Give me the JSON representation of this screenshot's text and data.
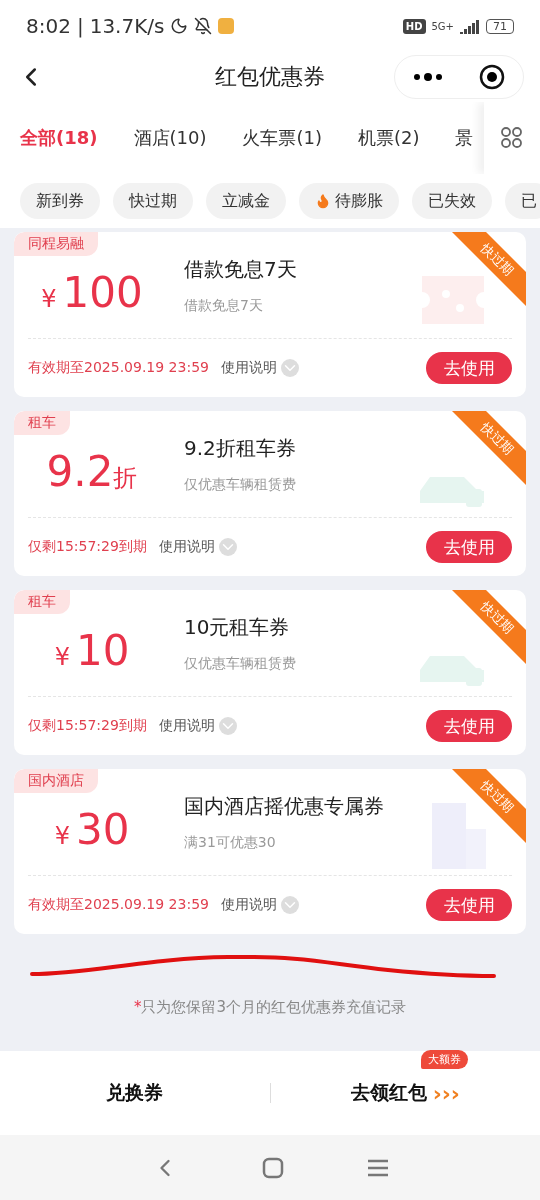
{
  "status_bar": {
    "time": "8:02",
    "separator": "|",
    "speed": "13.7K/s",
    "hd": "HD",
    "network": "5G+",
    "battery": "71"
  },
  "nav": {
    "title": "红包优惠券"
  },
  "tabs": [
    {
      "label": "全部(18)",
      "selected": true
    },
    {
      "label": "酒店(10)",
      "selected": false
    },
    {
      "label": "火车票(1)",
      "selected": false
    },
    {
      "label": "机票(2)",
      "selected": false
    },
    {
      "label": "景",
      "selected": false
    }
  ],
  "chips": [
    {
      "label": "新到券",
      "hot": false
    },
    {
      "label": "快过期",
      "hot": false
    },
    {
      "label": "立减金",
      "hot": false
    },
    {
      "label": "待膨胀",
      "hot": true
    },
    {
      "label": "已失效",
      "hot": false
    },
    {
      "label": "已",
      "hot": false
    }
  ],
  "coupons": [
    {
      "tag": "同程易融",
      "amount": {
        "kind": "yuan",
        "symbol": "¥",
        "value": "100"
      },
      "title": "借款免息7天",
      "desc": "借款免息7天",
      "ribbon": "快过期",
      "kind": "ticket",
      "expiry": "有效期至2025.09.19 23:59",
      "help": "使用说明",
      "action": "去使用"
    },
    {
      "tag": "租车",
      "amount": {
        "kind": "discount",
        "value": "9.2",
        "unit": "折"
      },
      "title": "9.2折租车券",
      "desc": "仅优惠车辆租赁费",
      "ribbon": "快过期",
      "kind": "car",
      "expiry": "仅剩15:57:29到期",
      "help": "使用说明",
      "action": "去使用"
    },
    {
      "tag": "租车",
      "amount": {
        "kind": "yuan",
        "symbol": "¥",
        "value": "10"
      },
      "title": "10元租车券",
      "desc": "仅优惠车辆租赁费",
      "ribbon": "快过期",
      "kind": "car",
      "expiry": "仅剩15:57:29到期",
      "help": "使用说明",
      "action": "去使用"
    },
    {
      "tag": "国内酒店",
      "amount": {
        "kind": "yuan",
        "symbol": "¥",
        "value": "30"
      },
      "title": "国内酒店摇优惠专属券",
      "desc": "满31可优惠30",
      "ribbon": "快过期",
      "kind": "building",
      "expiry": "有效期至2025.09.19 23:59",
      "help": "使用说明",
      "action": "去使用"
    }
  ],
  "note": {
    "mark": "*",
    "text": "只为您保留3个月的红包优惠券充值记录"
  },
  "bottom_bar": {
    "left": "兑换券",
    "right": "去领红包",
    "badge": "大额券",
    "arrows": "›››"
  }
}
